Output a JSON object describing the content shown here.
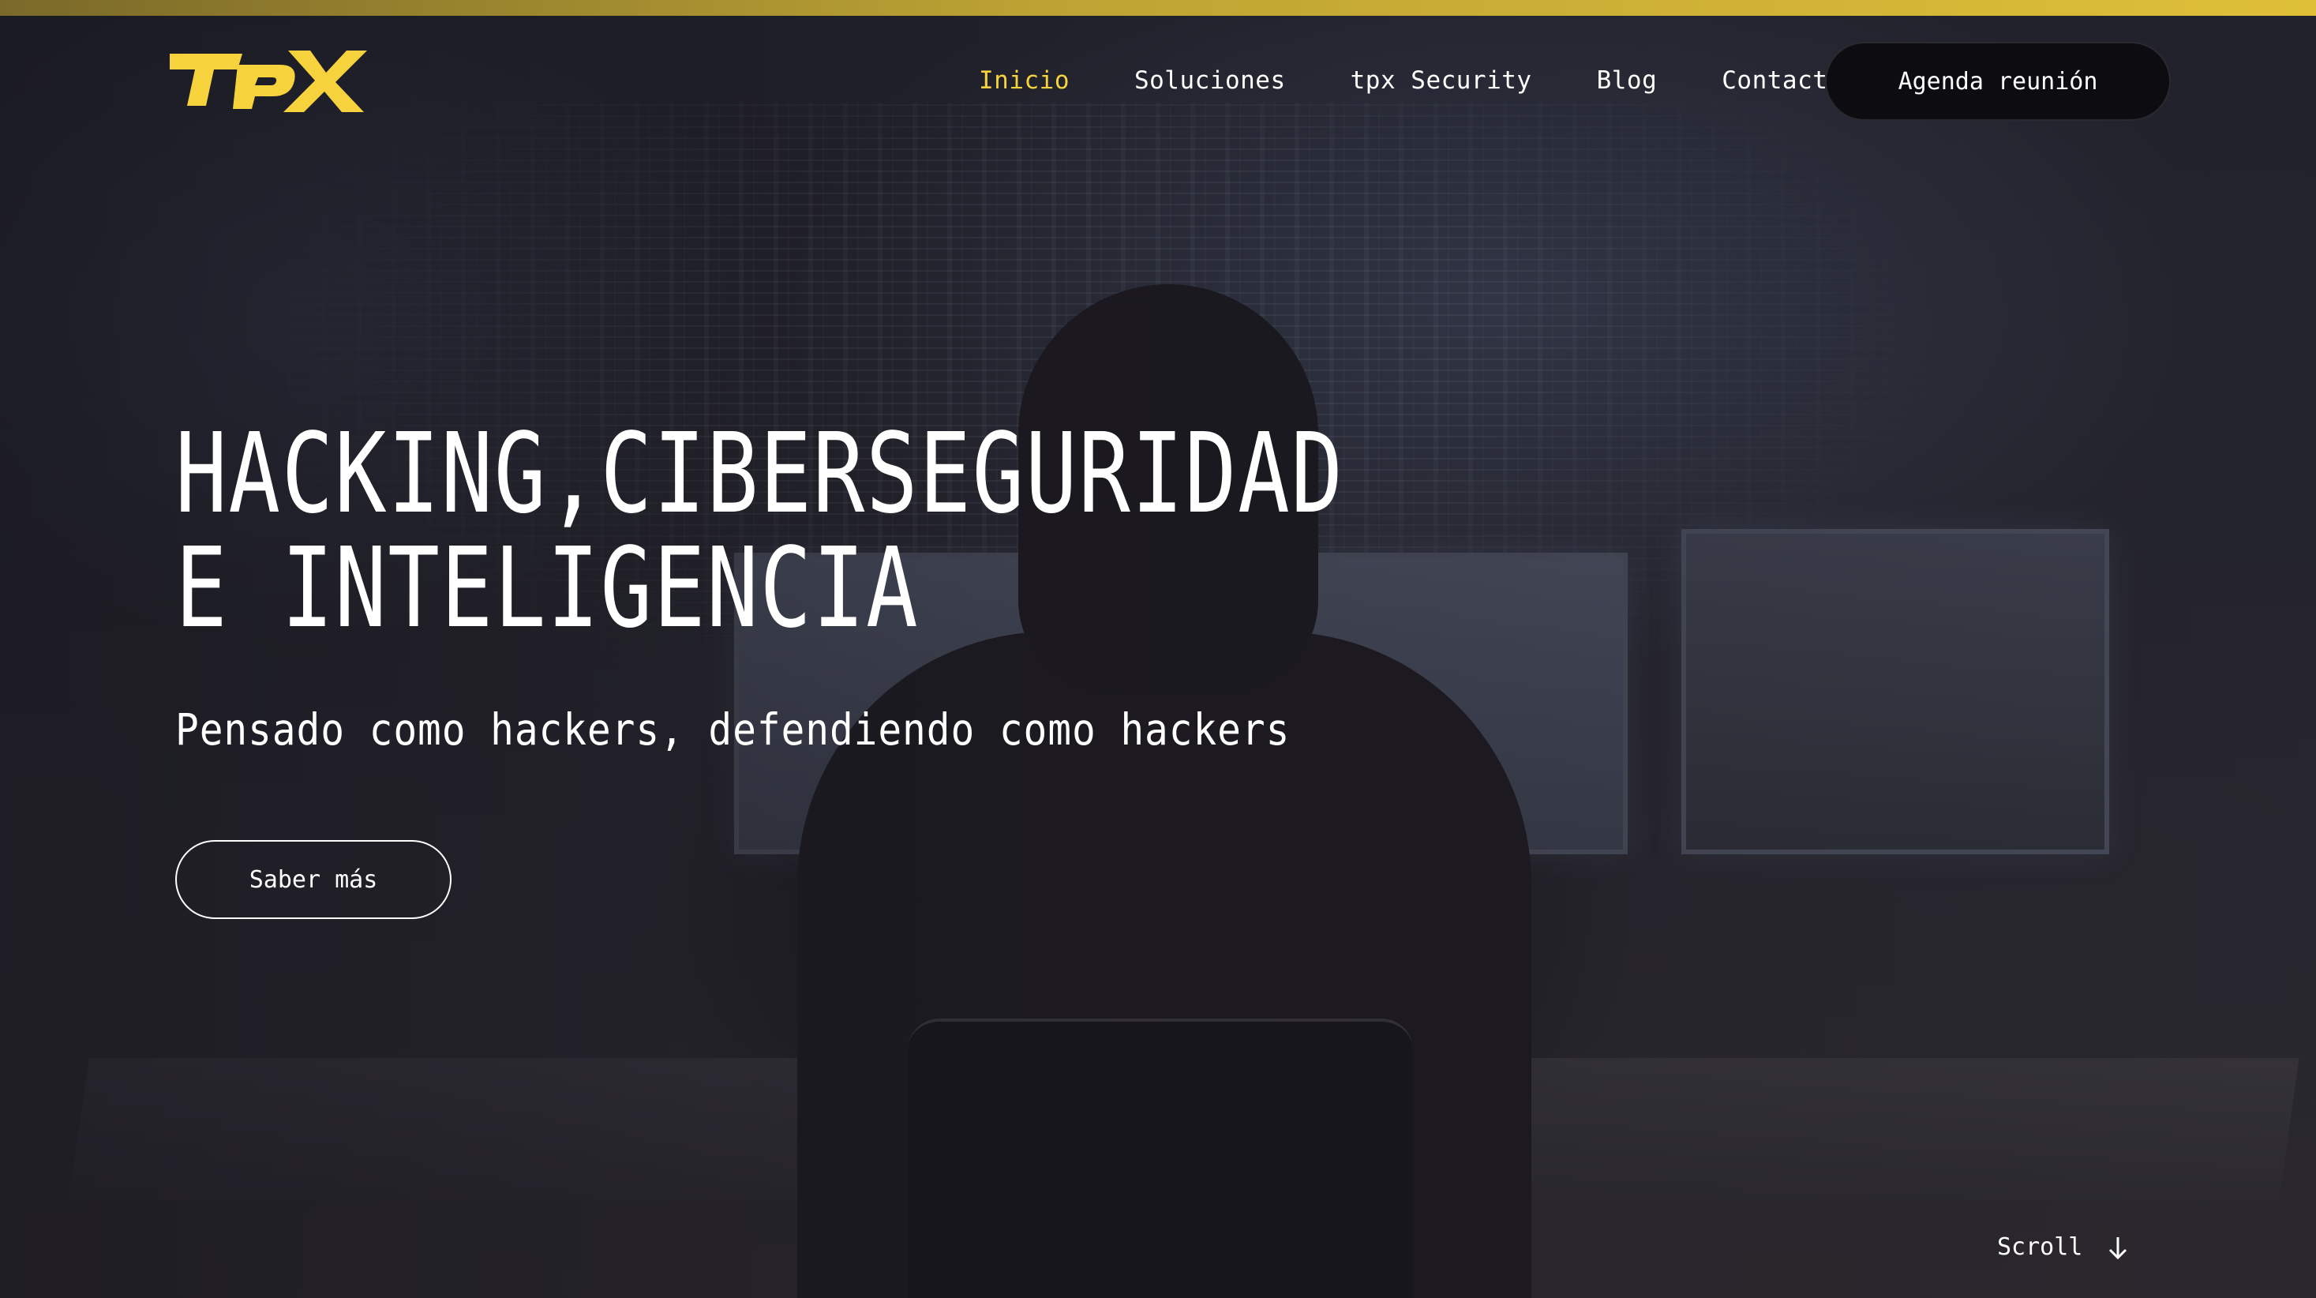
{
  "brand": {
    "logo_text": "TPX",
    "accent_color": "#f6d33c"
  },
  "nav": {
    "items": [
      {
        "label": "Inicio",
        "active": true
      },
      {
        "label": "Soluciones",
        "active": false
      },
      {
        "label": "tpx Security",
        "active": false
      },
      {
        "label": "Blog",
        "active": false
      },
      {
        "label": "Contacto",
        "active": false
      }
    ],
    "cta_label": "Agenda reunión"
  },
  "hero": {
    "title_line1": "HACKING,CIBERSEGURIDAD",
    "title_line2": "E INTELIGENCIA",
    "subtitle": "Pensado como hackers, defendiendo como hackers",
    "button_label": "Saber más"
  },
  "scroll": {
    "label": "Scroll",
    "icon": "arrow-down-icon"
  }
}
